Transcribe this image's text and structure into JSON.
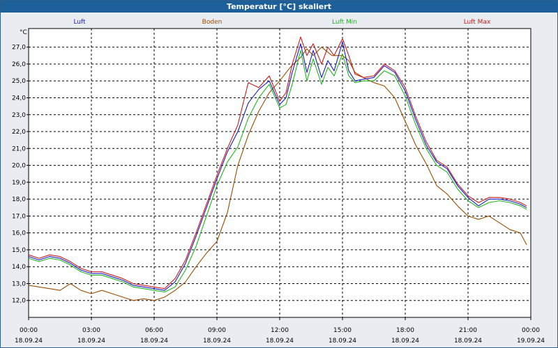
{
  "window": {
    "title": "Temperatur [°C] skaliert"
  },
  "chart_data": {
    "type": "line",
    "title": "Temperatur [°C] skaliert",
    "ylabel": "°C",
    "ylim": [
      11.0,
      28.1
    ],
    "y_ticks": [
      "12,0",
      "13,0",
      "14,0",
      "15,0",
      "16,0",
      "17,0",
      "18,0",
      "19,0",
      "20,0",
      "21,0",
      "22,0",
      "23,0",
      "24,0",
      "25,0",
      "26,0",
      "27,0"
    ],
    "y_tick_values": [
      12,
      13,
      14,
      15,
      16,
      17,
      18,
      19,
      20,
      21,
      22,
      23,
      24,
      25,
      26,
      27
    ],
    "xlim": [
      0,
      24
    ],
    "x_tick_hours": [
      0,
      3,
      6,
      9,
      12,
      15,
      18,
      21,
      24
    ],
    "x_tick_times": [
      "00:00",
      "03:00",
      "06:00",
      "09:00",
      "12:00",
      "15:00",
      "18:00",
      "21:00",
      "00:00"
    ],
    "x_tick_dates": [
      "18.09.24",
      "18.09.24",
      "18.09.24",
      "18.09.24",
      "18.09.24",
      "18.09.24",
      "18.09.24",
      "18.09.24",
      "19.09.24"
    ],
    "grid": true,
    "legend_position": "top",
    "series": [
      {
        "name": "Luft",
        "color": "#1a1acc",
        "points": [
          [
            0,
            14.6
          ],
          [
            0.5,
            14.4
          ],
          [
            1,
            14.6
          ],
          [
            1.5,
            14.5
          ],
          [
            2,
            14.2
          ],
          [
            2.5,
            13.8
          ],
          [
            3,
            13.6
          ],
          [
            3.5,
            13.6
          ],
          [
            4,
            13.4
          ],
          [
            4.5,
            13.2
          ],
          [
            5,
            12.9
          ],
          [
            5.5,
            12.8
          ],
          [
            6,
            12.7
          ],
          [
            6.5,
            12.6
          ],
          [
            7,
            13.1
          ],
          [
            7.5,
            14.2
          ],
          [
            8,
            15.8
          ],
          [
            8.5,
            17.5
          ],
          [
            9,
            19.2
          ],
          [
            9.5,
            20.8
          ],
          [
            10,
            22.0
          ],
          [
            10.5,
            23.7
          ],
          [
            11,
            24.5
          ],
          [
            11.5,
            25.0
          ],
          [
            12,
            23.6
          ],
          [
            12.3,
            24.0
          ],
          [
            12.6,
            25.5
          ],
          [
            13,
            27.2
          ],
          [
            13.3,
            25.5
          ],
          [
            13.6,
            26.8
          ],
          [
            14,
            25.2
          ],
          [
            14.3,
            26.2
          ],
          [
            14.6,
            25.6
          ],
          [
            15,
            27.3
          ],
          [
            15.3,
            25.6
          ],
          [
            15.6,
            25.0
          ],
          [
            16,
            25.1
          ],
          [
            16.5,
            25.2
          ],
          [
            17,
            25.9
          ],
          [
            17.5,
            25.5
          ],
          [
            18,
            24.4
          ],
          [
            18.5,
            22.7
          ],
          [
            19,
            21.2
          ],
          [
            19.5,
            20.2
          ],
          [
            20,
            19.8
          ],
          [
            20.5,
            18.8
          ],
          [
            21,
            18.1
          ],
          [
            21.5,
            17.6
          ],
          [
            22,
            18.0
          ],
          [
            22.5,
            18.0
          ],
          [
            23,
            17.9
          ],
          [
            23.5,
            17.7
          ],
          [
            23.8,
            17.5
          ]
        ]
      },
      {
        "name": "Boden",
        "color": "#994d00",
        "points": [
          [
            0,
            12.9
          ],
          [
            0.5,
            12.8
          ],
          [
            1,
            12.7
          ],
          [
            1.5,
            12.6
          ],
          [
            2,
            13.0
          ],
          [
            2.5,
            12.6
          ],
          [
            3,
            12.4
          ],
          [
            3.5,
            12.6
          ],
          [
            4,
            12.4
          ],
          [
            4.5,
            12.2
          ],
          [
            5,
            12.0
          ],
          [
            5.5,
            12.1
          ],
          [
            6,
            12.0
          ],
          [
            6.5,
            12.2
          ],
          [
            7,
            12.6
          ],
          [
            7.5,
            13.1
          ],
          [
            8,
            14.0
          ],
          [
            8.5,
            14.8
          ],
          [
            9,
            15.5
          ],
          [
            9.5,
            17.2
          ],
          [
            10,
            20.0
          ],
          [
            10.5,
            21.8
          ],
          [
            11,
            23.2
          ],
          [
            11.5,
            24.3
          ],
          [
            12,
            25.0
          ],
          [
            12.5,
            25.8
          ],
          [
            13,
            26.4
          ],
          [
            13.3,
            26.9
          ],
          [
            13.6,
            26.5
          ],
          [
            14,
            27.0
          ],
          [
            14.5,
            26.5
          ],
          [
            15,
            26.5
          ],
          [
            15.3,
            26.2
          ],
          [
            15.6,
            25.5
          ],
          [
            16,
            25.2
          ],
          [
            16.5,
            24.9
          ],
          [
            17,
            24.7
          ],
          [
            17.5,
            24.0
          ],
          [
            18,
            22.6
          ],
          [
            18.5,
            21.2
          ],
          [
            19,
            20.1
          ],
          [
            19.5,
            18.8
          ],
          [
            20,
            18.3
          ],
          [
            20.5,
            17.6
          ],
          [
            21,
            17.0
          ],
          [
            21.5,
            16.8
          ],
          [
            22,
            17.0
          ],
          [
            22.5,
            16.6
          ],
          [
            23,
            16.2
          ],
          [
            23.5,
            16.0
          ],
          [
            23.8,
            15.3
          ]
        ]
      },
      {
        "name": "Luft Min",
        "color": "#1fb81f",
        "points": [
          [
            0,
            14.5
          ],
          [
            0.5,
            14.3
          ],
          [
            1,
            14.5
          ],
          [
            1.5,
            14.4
          ],
          [
            2,
            14.1
          ],
          [
            2.5,
            13.7
          ],
          [
            3,
            13.5
          ],
          [
            3.5,
            13.5
          ],
          [
            4,
            13.3
          ],
          [
            4.5,
            13.1
          ],
          [
            5,
            12.8
          ],
          [
            5.5,
            12.7
          ],
          [
            6,
            12.6
          ],
          [
            6.5,
            12.5
          ],
          [
            7,
            12.8
          ],
          [
            7.5,
            13.8
          ],
          [
            8,
            15.2
          ],
          [
            8.5,
            17.0
          ],
          [
            9,
            18.8
          ],
          [
            9.5,
            20.2
          ],
          [
            10,
            21.1
          ],
          [
            10.5,
            22.8
          ],
          [
            11,
            24.0
          ],
          [
            11.5,
            24.8
          ],
          [
            12,
            23.4
          ],
          [
            12.3,
            23.6
          ],
          [
            12.6,
            24.8
          ],
          [
            13,
            26.8
          ],
          [
            13.3,
            25.0
          ],
          [
            13.6,
            26.3
          ],
          [
            14,
            24.8
          ],
          [
            14.3,
            25.8
          ],
          [
            14.6,
            25.3
          ],
          [
            15,
            26.6
          ],
          [
            15.3,
            25.3
          ],
          [
            15.6,
            24.9
          ],
          [
            16,
            25.0
          ],
          [
            16.5,
            25.0
          ],
          [
            17,
            25.6
          ],
          [
            17.5,
            25.3
          ],
          [
            18,
            24.1
          ],
          [
            18.5,
            22.4
          ],
          [
            19,
            21.0
          ],
          [
            19.5,
            20.0
          ],
          [
            20,
            19.6
          ],
          [
            20.5,
            18.6
          ],
          [
            21,
            17.9
          ],
          [
            21.5,
            17.5
          ],
          [
            22,
            17.8
          ],
          [
            22.5,
            17.9
          ],
          [
            23,
            17.8
          ],
          [
            23.5,
            17.6
          ],
          [
            23.8,
            17.4
          ]
        ]
      },
      {
        "name": "Luft Max",
        "color": "#cc1a1a",
        "points": [
          [
            0,
            14.7
          ],
          [
            0.5,
            14.5
          ],
          [
            1,
            14.7
          ],
          [
            1.5,
            14.6
          ],
          [
            2,
            14.3
          ],
          [
            2.5,
            13.9
          ],
          [
            3,
            13.7
          ],
          [
            3.5,
            13.7
          ],
          [
            4,
            13.5
          ],
          [
            4.5,
            13.3
          ],
          [
            5,
            13.0
          ],
          [
            5.5,
            12.9
          ],
          [
            6,
            12.8
          ],
          [
            6.5,
            12.7
          ],
          [
            7,
            13.3
          ],
          [
            7.5,
            14.4
          ],
          [
            8,
            16.0
          ],
          [
            8.5,
            17.7
          ],
          [
            9,
            19.4
          ],
          [
            9.5,
            21.0
          ],
          [
            10,
            22.4
          ],
          [
            10.5,
            24.9
          ],
          [
            11,
            24.6
          ],
          [
            11.5,
            25.3
          ],
          [
            12,
            23.8
          ],
          [
            12.3,
            24.3
          ],
          [
            12.6,
            26.0
          ],
          [
            13,
            27.6
          ],
          [
            13.3,
            26.5
          ],
          [
            13.6,
            27.2
          ],
          [
            14,
            26.0
          ],
          [
            14.3,
            27.0
          ],
          [
            14.6,
            26.5
          ],
          [
            15,
            27.5
          ],
          [
            15.3,
            26.5
          ],
          [
            15.6,
            25.4
          ],
          [
            16,
            25.2
          ],
          [
            16.5,
            25.3
          ],
          [
            17,
            26.0
          ],
          [
            17.5,
            25.6
          ],
          [
            18,
            24.6
          ],
          [
            18.5,
            22.9
          ],
          [
            19,
            21.4
          ],
          [
            19.5,
            20.3
          ],
          [
            20,
            19.9
          ],
          [
            20.5,
            18.9
          ],
          [
            21,
            18.2
          ],
          [
            21.5,
            17.8
          ],
          [
            22,
            18.1
          ],
          [
            22.5,
            18.1
          ],
          [
            23,
            18.0
          ],
          [
            23.5,
            17.8
          ],
          [
            23.8,
            17.6
          ]
        ]
      }
    ]
  }
}
